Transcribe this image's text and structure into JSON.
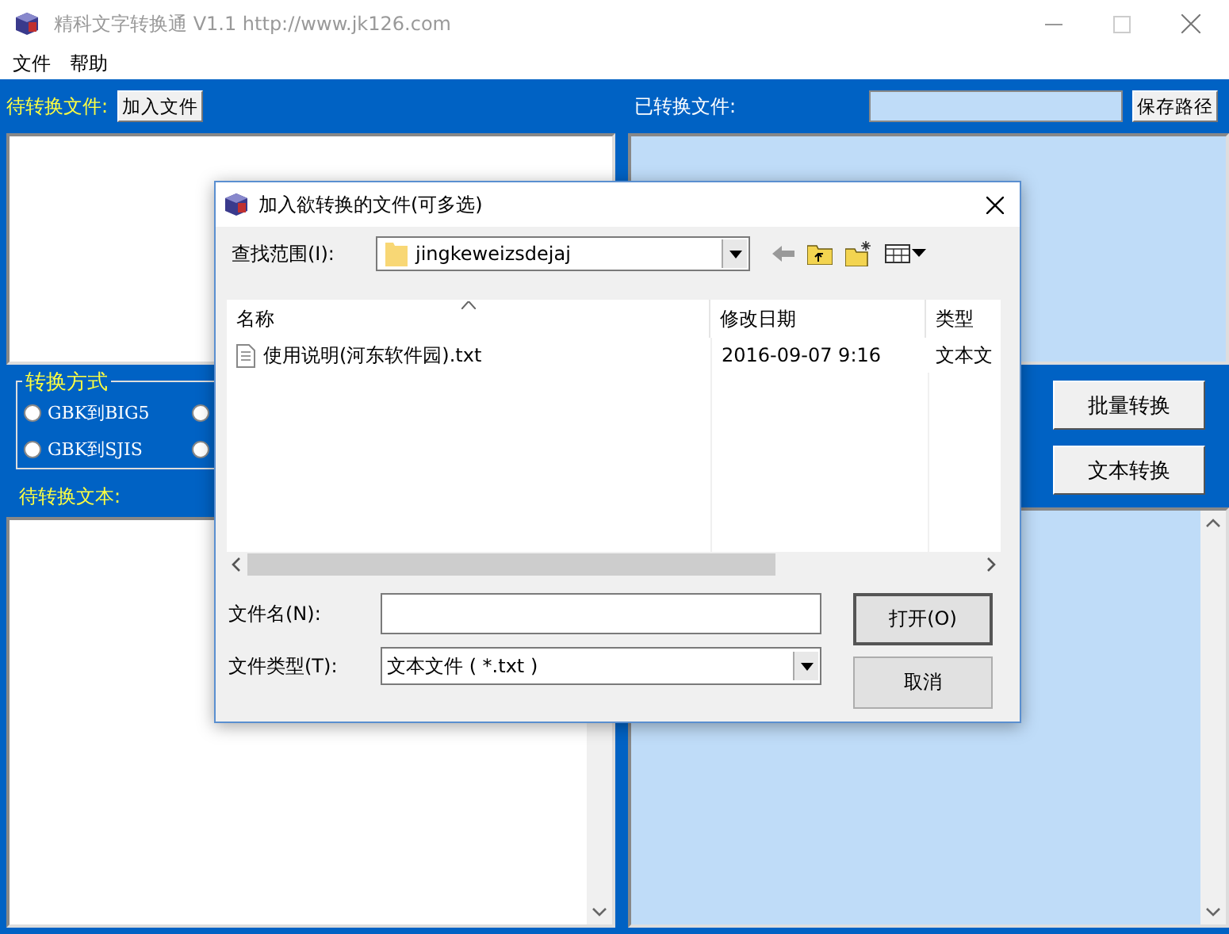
{
  "window": {
    "title": "精科文字转换通 V1.1  http://www.jk126.com",
    "menu": [
      "文件",
      "帮助"
    ]
  },
  "pending_files": {
    "label": "待转换文件:",
    "add_button": "加入文件"
  },
  "converted_files": {
    "label": "已转换文件:",
    "save_button": "保存路径"
  },
  "conversion_mode": {
    "title": "转换方式",
    "options": [
      {
        "label": "GBK到BIG5",
        "selected": false
      },
      {
        "selected": false
      },
      {
        "label": "GBK到SJIS",
        "selected": false
      },
      {
        "selected": false
      }
    ]
  },
  "actions": [
    "批量转换",
    "文本转换"
  ],
  "pending_text": {
    "label": "待转换文本:"
  },
  "dialog": {
    "title": "加入欲转换的文件(可多选)",
    "look_in_label": "查找范围(I):",
    "look_in_value": "jingkeweizsdejaj",
    "columns": [
      {
        "label": "名称",
        "sorted": true
      },
      {
        "label": "修改日期",
        "sorted": false
      },
      {
        "label": "类型",
        "sorted": false
      }
    ],
    "files": [
      {
        "name": "使用说明(河东软件园).txt",
        "modified": "2016-09-07 9:16",
        "type": "文本文"
      }
    ],
    "file_name_label": "文件名(N):",
    "file_type_label": "文件类型(T):",
    "file_type_value": "文本文件 ( *.txt )",
    "buttons": [
      "打开(O)",
      "取消"
    ]
  }
}
